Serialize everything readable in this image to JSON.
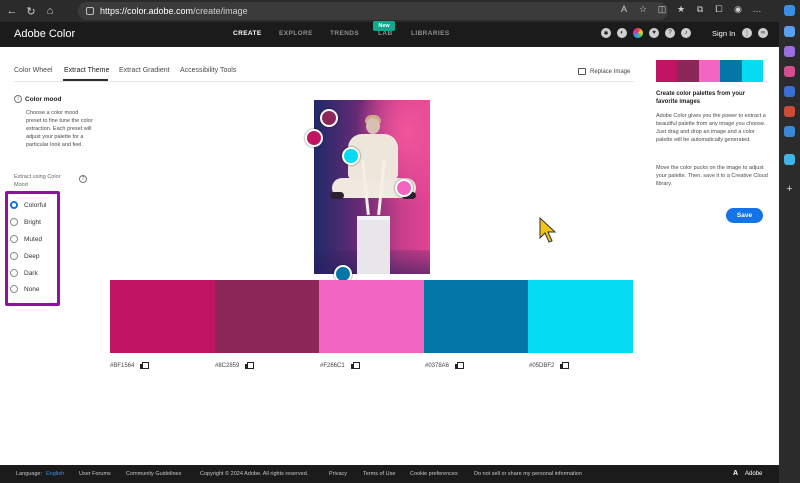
{
  "browser": {
    "url_domain": "https://color.adobe.com",
    "url_path": "/create/image"
  },
  "nav": {
    "brand": "Adobe Color",
    "tabs": [
      "CREATE",
      "EXPLORE",
      "TRENDS",
      "LAB",
      "LIBRARIES"
    ],
    "active_tab": "CREATE",
    "lab_badge": "New",
    "sign_in": "Sign In"
  },
  "subtabs": {
    "items": [
      "Color Wheel",
      "Extract Theme",
      "Extract Gradient",
      "Accessibility Tools"
    ],
    "active": "Extract Theme",
    "replace_image": "Replace Image"
  },
  "left_panel": {
    "color_mood_title": "Color mood",
    "color_mood_desc": "Choose a color mood preset to fine tune the color extraction. Each preset will adjust your palette for a particular look and feel.",
    "extract_label": "Extract using Color Mood",
    "moods": [
      "Colorful",
      "Bright",
      "Muted",
      "Deep",
      "Dark",
      "None"
    ],
    "selected_mood": "Colorful"
  },
  "palette": {
    "colors": [
      "#BF1564",
      "#8C2859",
      "#F266C1",
      "#0378A6",
      "#05DBF2"
    ],
    "hex_labels": [
      "#BF1564",
      "#8C2859",
      "#F266C1",
      "#0378A6",
      "#05DBF2"
    ]
  },
  "right_panel": {
    "title": "Create color palettes from your favorite images",
    "para1": "Adobe Color gives you the power to extract a beautiful palette from any image you choose. Just drag and drop an image and a color palette will be automatically generated.",
    "para2": "Move the color pucks on the image to adjust your palette. Then, save it to a Creative Cloud library.",
    "save_label": "Save"
  },
  "footer": {
    "language_label": "Language:",
    "language": "English",
    "links": [
      "User Forums",
      "Community Guidelines",
      "Copyright © 2024 Adobe. All rights reserved.",
      "Privacy",
      "Terms of Use",
      "Cookie preferences",
      "Do not sell or share my personal information"
    ],
    "adobe": "Adobe"
  }
}
